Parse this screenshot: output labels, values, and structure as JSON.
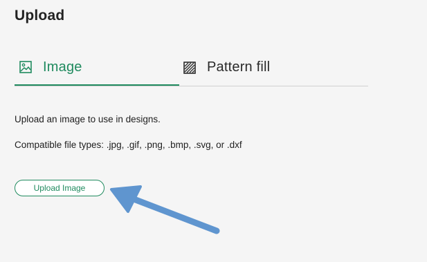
{
  "page": {
    "title": "Upload"
  },
  "tabs": [
    {
      "label": "Image",
      "icon": "image-icon",
      "active": true
    },
    {
      "label": "Pattern fill",
      "icon": "pattern-fill-icon",
      "active": false
    }
  ],
  "content": {
    "description": "Upload an image to use in designs.",
    "file_types": "Compatible file types: .jpg, .gif, .png, .bmp, .svg, or .dxf",
    "upload_button_label": "Upload Image"
  },
  "colors": {
    "accent": "#1f8a5e",
    "annotation_arrow": "#5f95cf",
    "background": "#f5f5f5"
  }
}
